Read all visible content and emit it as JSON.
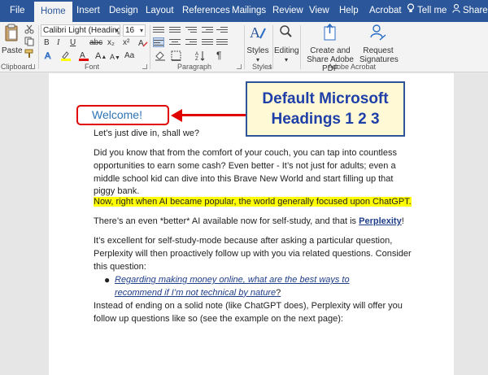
{
  "tabs": [
    {
      "label": "File"
    },
    {
      "label": "Home"
    },
    {
      "label": "Insert"
    },
    {
      "label": "Design"
    },
    {
      "label": "Layout"
    },
    {
      "label": "References"
    },
    {
      "label": "Mailings"
    },
    {
      "label": "Review"
    },
    {
      "label": "View"
    },
    {
      "label": "Help"
    },
    {
      "label": "Acrobat"
    },
    {
      "label": "Tell me"
    },
    {
      "label": "Share"
    }
  ],
  "ribbon": {
    "clipboard": {
      "label": "Clipboard",
      "paste_label": "Paste"
    },
    "font": {
      "label": "Font",
      "font_name": "Calibri Light (Headings)",
      "font_size": "16",
      "bold": "B",
      "italic": "I",
      "underline": "U",
      "strike": "abc",
      "subscript": "x₂",
      "superscript": "x²",
      "grow": "A",
      "shrink": "A",
      "change_case": "Aa"
    },
    "paragraph": {
      "label": "Paragraph"
    },
    "styles": {
      "label": "Styles",
      "button_label": "Styles"
    },
    "editing": {
      "button_label": "Editing"
    },
    "acrobat": {
      "label": "Adobe Acrobat",
      "create_share": "Create and Share Adobe PDF",
      "request_sig": "Request Signatures"
    }
  },
  "document": {
    "heading": "Welcome!",
    "callout": "Default Microsoft Headings 1 2 3",
    "paragraphs": [
      "Let’s just dive in, shall we?",
      "Did you know that from the comfort of your couch, you can tap into countless opportunities to earn some cash?  Even better - It’s not just for adults; even a middle school kid can dive into this Brave New World and start filling up that piggy bank.",
      "Now, right when AI became popular, the world generally focused upon ChatGPT.",
      "There’s an even *better* AI available now for self-study, and that is ",
      "Perplexity",
      "!",
      "It’s excellent for self-study-mode because after asking a particular question, Perplexity will then proactively follow up with you via related questions.  Consider this question:",
      "Regarding making money online, what are the best ways to recommend if I’m not technical by nature",
      "?",
      "Instead of ending on a solid note (like ChatGPT does), Perplexity will offer you follow up questions like so (see the example on the next page):"
    ]
  },
  "colors": {
    "ribbon_blue": "#2b579a",
    "heading_blue": "#2e74b5",
    "annotation_red": "#e00000",
    "highlight": "#ffff00"
  }
}
